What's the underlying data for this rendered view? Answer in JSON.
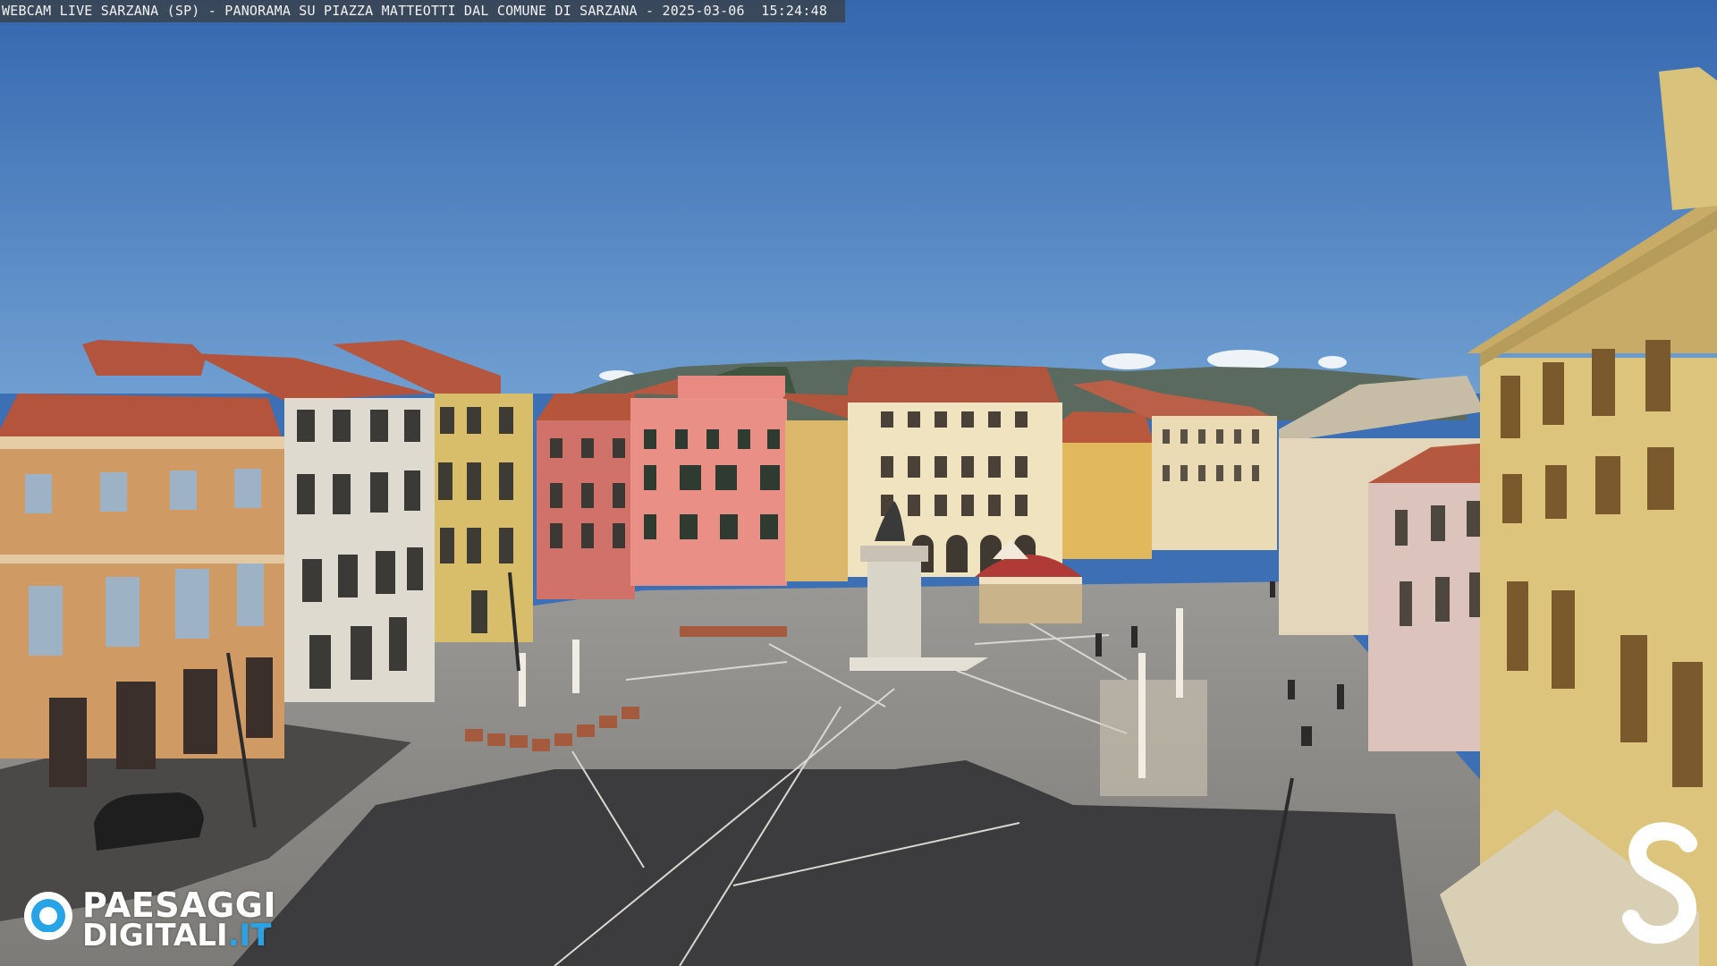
{
  "overlay": {
    "caption": "WEBCAM LIVE SARZANA (SP) - PANORAMA SU PIAZZA MATTEOTTI DAL COMUNE DI SARZANA - 2025-03-06  15:24:48"
  },
  "watermark": {
    "line1": "PAESAGGI",
    "line2_main": "DIGITALI",
    "line2_tld": ".IT",
    "icon": "eye-camera-logo-icon",
    "tld_color": "#27a3e6"
  },
  "corner_logo": {
    "icon": "s-letter-logo-icon"
  },
  "scene": {
    "sky_color": "#3f73b8",
    "pavement_color": "#8f8f8d",
    "shadow_color": "#3d3d3f"
  }
}
